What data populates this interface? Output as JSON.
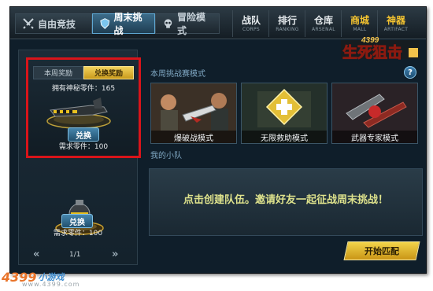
{
  "tabs": [
    {
      "label": "自由竞技",
      "icon": "crossed-swords-icon"
    },
    {
      "label": "周末挑战",
      "icon": "shield-icon",
      "active": true
    },
    {
      "label": "冒险模式",
      "icon": "skull-icon"
    }
  ],
  "nav": [
    {
      "title": "战队",
      "sub": "CORPS"
    },
    {
      "title": "排行",
      "sub": "RANKING"
    },
    {
      "title": "仓库",
      "sub": "ARSENAL"
    },
    {
      "title": "商城",
      "sub": "MALL"
    },
    {
      "title": "神器",
      "sub": "ARTIFACT"
    }
  ],
  "logo": {
    "top": "4399",
    "main": "生死狙击"
  },
  "left": {
    "subtabs": [
      "本周奖励",
      "兑换奖励"
    ],
    "owned_parts": "拥有神秘零件：165",
    "item1": {
      "exchange_label": "兑换",
      "requirement": "需求零件：100"
    },
    "item2": {
      "exchange_label": "兑换",
      "requirement": "需求零件：100"
    },
    "page": "1/1",
    "prev": "«",
    "next": "»"
  },
  "right": {
    "modes_title": "本周挑战赛模式",
    "help": "?",
    "modes": [
      "爆破战模式",
      "无限救助模式",
      "武器专家模式"
    ],
    "team_title": "我的小队",
    "team_hint": "点击创建队伍。邀请好友一起征战周末挑战！",
    "match_button": "开始匹配"
  },
  "watermark": {
    "brand": "4399",
    "suffix": "小游戏",
    "url": "www.4399.com"
  },
  "colors": {
    "accent_gold": "#f2d44a",
    "active_tab": "#3c6c8a",
    "highlight_red": "#d9141a"
  }
}
